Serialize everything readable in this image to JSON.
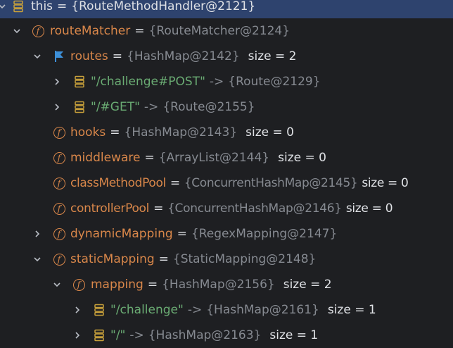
{
  "rows": [
    {
      "name": "this",
      "type": "{RouteMethodHandler@2121}"
    },
    {
      "name": "routeMatcher",
      "type": "{RouteMatcher@2124}"
    },
    {
      "name": "routes",
      "type": "{HashMap@2142}",
      "size": "size = 2"
    },
    {
      "key": "\"/challenge#POST\"",
      "arrow": "->",
      "type": "{Route@2129}"
    },
    {
      "key": "\"/#GET\"",
      "arrow": "->",
      "type": "{Route@2155}"
    },
    {
      "name": "hooks",
      "type": "{HashMap@2143}",
      "size": "size = 0"
    },
    {
      "name": "middleware",
      "type": "{ArrayList@2144}",
      "size": "size = 0"
    },
    {
      "name": "classMethodPool",
      "type": "{ConcurrentHashMap@2145}",
      "size": "size = 0"
    },
    {
      "name": "controllerPool",
      "type": "{ConcurrentHashMap@2146}",
      "size": "size = 0"
    },
    {
      "name": "dynamicMapping",
      "type": "{RegexMapping@2147}"
    },
    {
      "name": "staticMapping",
      "type": "{StaticMapping@2148}"
    },
    {
      "name": "mapping",
      "type": "{HashMap@2156}",
      "size": "size = 2"
    },
    {
      "key": "\"/challenge\"",
      "arrow": "->",
      "type": "{HashMap@2161}",
      "size": "size = 1"
    },
    {
      "key": "\"/\"",
      "arrow": "->",
      "type": "{HashMap@2163}",
      "size": "size = 1"
    }
  ],
  "eq": "=",
  "colors": {
    "background": "#1e1f22",
    "selection": "#2e436e",
    "field": "#d9874a",
    "string": "#6aab73",
    "reference": "#868a91",
    "text": "#dfe1e5",
    "flag": "#3d8fd8",
    "entry_icon": "#c9a13b"
  },
  "icons": {
    "field": "field-icon",
    "flag": "flag-icon",
    "entry": "map-entry-icon",
    "expanded": "chevron-down-icon",
    "collapsed": "chevron-right-icon"
  }
}
